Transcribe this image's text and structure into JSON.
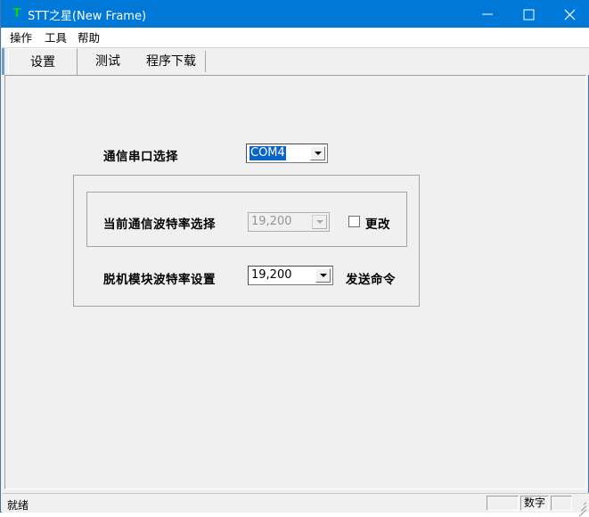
{
  "window": {
    "title": "STT之星(New Frame)",
    "icon": "app-t-icon",
    "accent_color": "#0078d7",
    "controls": {
      "minimize": "minimize-icon",
      "maximize": "maximize-icon",
      "close": "close-icon"
    }
  },
  "menubar": {
    "items": [
      {
        "label": "操作"
      },
      {
        "label": "工具"
      },
      {
        "label": "帮助"
      }
    ]
  },
  "tabs": {
    "selected_index": 0,
    "items": [
      {
        "label": "设置"
      },
      {
        "label": "测试"
      },
      {
        "label": "程序下载"
      }
    ]
  },
  "form": {
    "port": {
      "label": "通信串口选择",
      "value": "COM4",
      "selected": true
    },
    "current_baud": {
      "label": "当前通信波特率选择",
      "value": "19,200",
      "disabled": true,
      "change_checkbox": {
        "label": "更改",
        "checked": false
      }
    },
    "module_baud": {
      "label": "脱机模块波特率设置",
      "value": "19,200",
      "disabled": false,
      "send_label": "发送命令"
    }
  },
  "statusbar": {
    "message": "就绪",
    "pane_left": "",
    "pane_num": "数字",
    "pane_right": ""
  }
}
